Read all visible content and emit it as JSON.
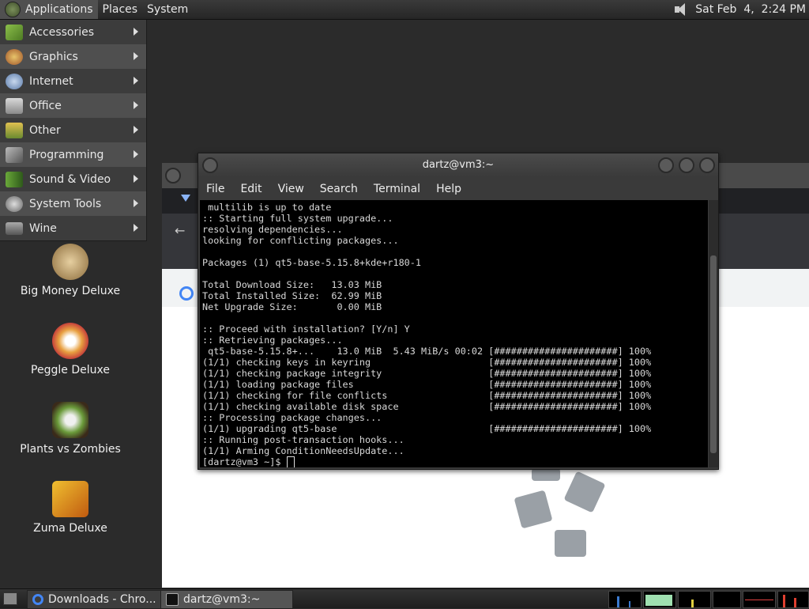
{
  "top_panel": {
    "menus": [
      "Applications",
      "Places",
      "System"
    ],
    "clock": "Sat Feb  4,  2:24 PM"
  },
  "apps_menu": {
    "items": [
      {
        "label": "Accessories",
        "icon": "accessories-icon"
      },
      {
        "label": "Graphics",
        "icon": "graphics-icon"
      },
      {
        "label": "Internet",
        "icon": "internet-icon"
      },
      {
        "label": "Office",
        "icon": "office-icon"
      },
      {
        "label": "Other",
        "icon": "other-icon"
      },
      {
        "label": "Programming",
        "icon": "programming-icon"
      },
      {
        "label": "Sound & Video",
        "icon": "sound-video-icon"
      },
      {
        "label": "System Tools",
        "icon": "system-tools-icon"
      },
      {
        "label": "Wine",
        "icon": "wine-icon"
      }
    ]
  },
  "desktop_icons": [
    {
      "label": "Big Money Deluxe"
    },
    {
      "label": "Peggle Deluxe"
    },
    {
      "label": "Plants vs Zombies"
    },
    {
      "label": "Zuma Deluxe"
    }
  ],
  "terminal": {
    "title": "dartz@vm3:~",
    "menus": [
      "File",
      "Edit",
      "View",
      "Search",
      "Terminal",
      "Help"
    ],
    "output": " multilib is up to date\n:: Starting full system upgrade...\nresolving dependencies...\nlooking for conflicting packages...\n\nPackages (1) qt5-base-5.15.8+kde+r180-1\n\nTotal Download Size:   13.03 MiB\nTotal Installed Size:  62.99 MiB\nNet Upgrade Size:       0.00 MiB\n\n:: Proceed with installation? [Y/n] Y\n:: Retrieving packages...\n qt5-base-5.15.8+...    13.0 MiB  5.43 MiB/s 00:02 [######################] 100%\n(1/1) checking keys in keyring                     [######################] 100%\n(1/1) checking package integrity                   [######################] 100%\n(1/1) loading package files                        [######################] 100%\n(1/1) checking for file conflicts                  [######################] 100%\n(1/1) checking available disk space                [######################] 100%\n:: Processing package changes...\n(1/1) upgrading qt5-base                           [######################] 100%\n:: Running post-transaction hooks...\n(1/1) Arming ConditionNeedsUpdate...\n",
    "prompt": "[dartz@vm3 ~]$ "
  },
  "taskbar": {
    "tasks": [
      {
        "label": "Downloads - Chro..."
      },
      {
        "label": "dartz@vm3:~"
      }
    ]
  },
  "colors": {
    "panel": "#2e2e2e",
    "menu_bg": "#3c3c3c",
    "terminal_bg": "#000000",
    "terminal_fg": "#d8d8d8"
  }
}
